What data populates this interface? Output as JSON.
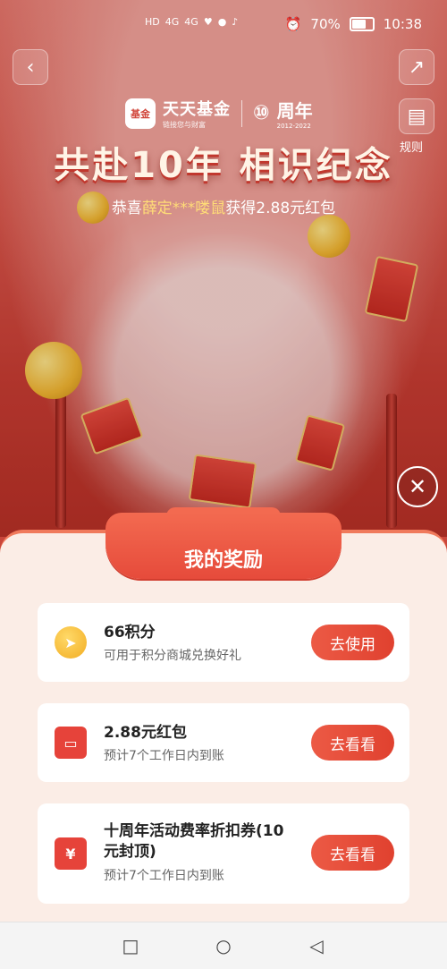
{
  "status_bar": {
    "left_indicators": [
      "HD",
      "4G",
      "4G"
    ],
    "battery": "70%",
    "time": "10:38"
  },
  "header": {
    "rules_label": "规则"
  },
  "brand": {
    "logo_text": "基金",
    "name": "天天基金",
    "slogan": "链接您与财富",
    "anniversary": "周年",
    "anniversary_years": "2012-2022"
  },
  "promo": {
    "headline": "共赴10年 相识纪念",
    "congrats_prefix": "恭喜",
    "congrats_user": "薛定***喽鼠",
    "congrats_suffix": "获得2.88元红包"
  },
  "rewards": {
    "title": "我的奖励",
    "items": [
      {
        "title": "66积分",
        "subtitle": "可用于积分商城兑换好礼",
        "action": "去使用",
        "icon": "points-icon"
      },
      {
        "title": "2.88元红包",
        "subtitle": "预计7个工作日内到账",
        "action": "去看看",
        "icon": "red-envelope-icon"
      },
      {
        "title": "十周年活动费率折扣券(10元封顶)",
        "subtitle": "预计7个工作日内到账",
        "action": "去看看",
        "icon": "coupon-icon",
        "icon_text": "¥"
      }
    ]
  },
  "colors": {
    "accent": "#e64b3b",
    "sheet_bg": "#fbede6",
    "highlight": "#ffdd77"
  }
}
